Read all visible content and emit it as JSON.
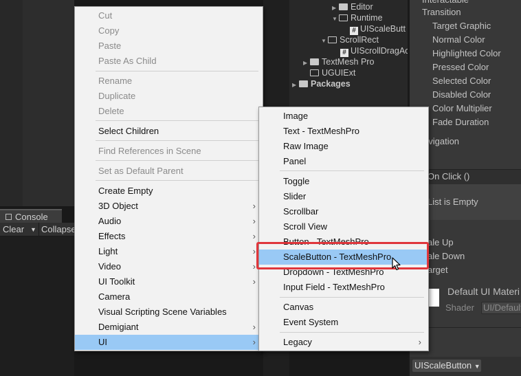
{
  "project": {
    "rows": [
      {
        "label": "Editor",
        "kind": "folder",
        "arrow": "▶"
      },
      {
        "label": "Runtime",
        "kind": "folder-open",
        "arrow": "▼"
      },
      {
        "label": "UIScaleButt",
        "kind": "script",
        "arrow": ""
      },
      {
        "label": "ScrollRect",
        "kind": "folder-open",
        "arrow": "▼"
      },
      {
        "label": "UIScrollDragAc",
        "kind": "script",
        "arrow": ""
      },
      {
        "label": "TextMesh Pro",
        "kind": "folder",
        "arrow": "▶"
      },
      {
        "label": "UGUIExt",
        "kind": "folder-open",
        "arrow": ""
      },
      {
        "label": "Packages",
        "kind": "folder",
        "arrow": "▶"
      }
    ]
  },
  "inspector": {
    "top_cut": "Interactable",
    "transition": "Transition",
    "props": [
      "Target Graphic",
      "Normal Color",
      "Highlighted Color",
      "Pressed Color",
      "Selected Color",
      "Disabled Color",
      "Color Multiplier",
      "Fade Duration"
    ],
    "navigation": "avigation",
    "on_click": "On Click ()",
    "list_empty": "List is Empty",
    "scale_up": "ale Up",
    "scale_down": "ale Down",
    "target": "arget",
    "material": "Default UI Materi",
    "shader_label": "Shader",
    "shader_value": "UI/Default",
    "footer_button": "UIScaleButton"
  },
  "console": {
    "tab": "Console",
    "clear": "Clear",
    "collapse": "Collapse"
  },
  "context_menu": {
    "items": [
      {
        "label": "Cut",
        "disabled": true
      },
      {
        "label": "Copy",
        "disabled": true
      },
      {
        "label": "Paste",
        "disabled": true
      },
      {
        "label": "Paste As Child",
        "disabled": true
      },
      {
        "label": "Rename",
        "disabled": true
      },
      {
        "label": "Duplicate",
        "disabled": true
      },
      {
        "label": "Delete",
        "disabled": true
      },
      {
        "label": "Select Children",
        "disabled": false
      },
      {
        "label": "Find References in Scene",
        "disabled": true
      },
      {
        "label": "Set as Default Parent",
        "disabled": true
      },
      {
        "label": "Create Empty",
        "disabled": false
      },
      {
        "label": "3D Object",
        "submenu": true
      },
      {
        "label": "Audio",
        "submenu": true
      },
      {
        "label": "Effects",
        "submenu": true
      },
      {
        "label": "Light",
        "submenu": true
      },
      {
        "label": "Video",
        "submenu": true
      },
      {
        "label": "UI Toolkit",
        "submenu": true
      },
      {
        "label": "Camera",
        "disabled": false
      },
      {
        "label": "Visual Scripting Scene Variables",
        "disabled": false
      },
      {
        "label": "Demigiant",
        "submenu": true
      },
      {
        "label": "UI",
        "submenu": true,
        "selected": true
      }
    ],
    "submenu_arrow": "›"
  },
  "ui_submenu": {
    "items": [
      "Image",
      "Text - TextMeshPro",
      "Raw Image",
      "Panel",
      "Toggle",
      "Slider",
      "Scrollbar",
      "Scroll View",
      "Button - TextMeshPro",
      "ScaleButton - TextMeshPro",
      "Dropdown - TextMeshPro",
      "Input Field - TextMeshPro",
      "Canvas",
      "Event System",
      "Legacy"
    ],
    "selected": "ScaleButton - TextMeshPro"
  },
  "colors": {
    "menu_bg": "#f2f2f2",
    "selection": "#99c9f5",
    "highlight_border": "#e0363c",
    "editor_bg": "#282828"
  }
}
